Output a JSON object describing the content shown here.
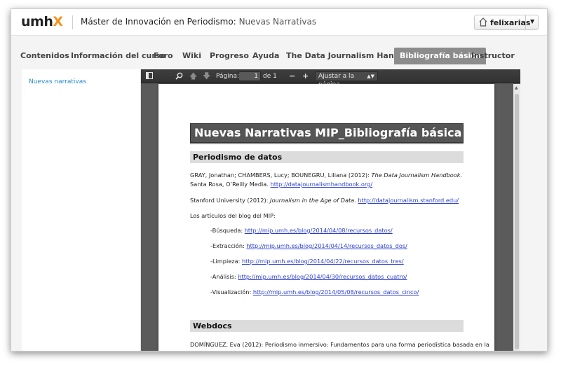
{
  "header": {
    "logo_main": "umh",
    "logo_accent": "X",
    "course_title": "Máster de Innovación en Periodismo:",
    "course_subtitle": "Nuevas Narrativas",
    "username": "felixarias"
  },
  "tabs": [
    {
      "label": "Contenidos"
    },
    {
      "label": "Información del curso"
    },
    {
      "label": "Foro"
    },
    {
      "label": "Wiki"
    },
    {
      "label": "Progreso"
    },
    {
      "label": "Ayuda"
    },
    {
      "label": "The Data Journalism Handbook"
    },
    {
      "label": "Bibliografía básica",
      "active": true
    },
    {
      "label": "Instructor"
    }
  ],
  "sidebar": {
    "link": "Nuevas narrativas"
  },
  "viewer": {
    "page_label": "Página:",
    "page_value": "1",
    "page_total": "de 1",
    "zoom": "Ajustar a la página"
  },
  "document": {
    "title": "Nuevas Narrativas MIP_Bibliografía básica",
    "sec1": "Periodismo de datos",
    "ref1_pre": "GRAY, Jonathan; CHAMBERS, Lucy; BOUNEGRU, Liliana (2012): ",
    "ref1_it": "The Data Journalism Handbook",
    "ref1_post": ". Santa Rosa, O’Reilly Media. ",
    "ref1_link": "http://datajournalismhandbook.org/",
    "ref2_pre": "Stanford University (2012): ",
    "ref2_it": "Journalism in the Age of Data",
    "ref2_post": ". ",
    "ref2_link": "http://datajournalism.stanford.edu/",
    "blog_intro": "Los artículos del blog del MIP:",
    "bullets": [
      {
        "label": "-Búsqueda: ",
        "link": "http://mip.umh.es/blog/2014/04/08/recursos_datos/"
      },
      {
        "label": "-Extracción: ",
        "link": "http://mip.umh.es/blog/2014/04/14/recursos_datos_dos/"
      },
      {
        "label": "-Limpieza: ",
        "link": "http://mip.umh.es/blog/2014/04/22/recursos_datos_tres/"
      },
      {
        "label": "-Análisis: ",
        "link": "http://mip.umh.es/blog/2014/04/30/recursos_datos_cuatro/"
      },
      {
        "label": "-Visualización: ",
        "link": "http://mip.umh.es/blog/2014/05/08/recursos_datos_cinco/"
      }
    ],
    "sec2": "Webdocs",
    "ref3": "DOMÍNGUEZ, Eva (2012): Periodismo inmersivo: Fundamentos para una forma periodística basada en la"
  }
}
